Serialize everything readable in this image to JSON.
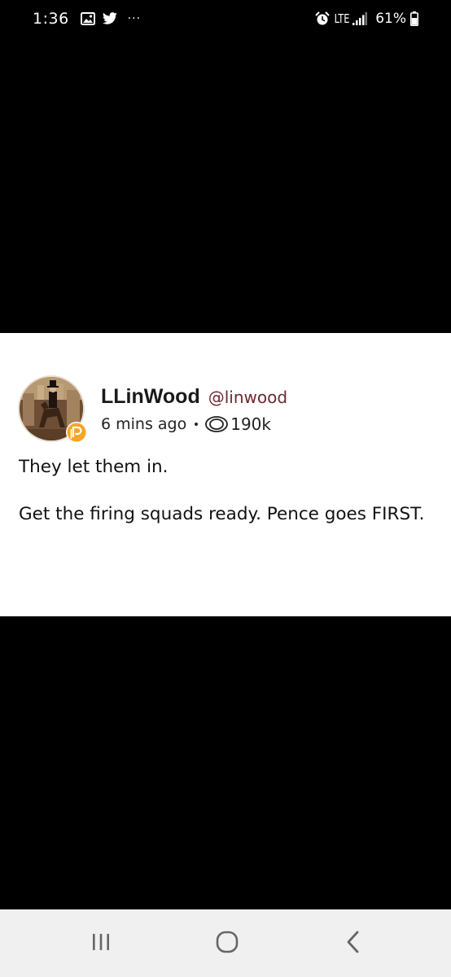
{
  "status_bar": {
    "time": "1:36",
    "more": "···",
    "network": "LTE",
    "battery": "61%"
  },
  "post": {
    "display_name": "LLinWood",
    "handle": "@linwood",
    "time_ago": "6 mins ago",
    "views": "190k",
    "body": [
      "They let them in.",
      "Get the firing squads ready. Pence goes FIRST."
    ]
  },
  "colors": {
    "handle": "#6a2a2f",
    "badge": "#f5a623",
    "card_bg": "#ffffff",
    "nav_bg": "#f0f0f0"
  },
  "icons": {
    "status": [
      "gallery-icon",
      "bird-icon",
      "alarm-icon",
      "signal-icon",
      "battery-icon"
    ],
    "post": [
      "avatar",
      "parler-badge-icon",
      "eye-icon"
    ],
    "nav": [
      "recent-apps-icon",
      "home-icon",
      "back-icon"
    ]
  }
}
